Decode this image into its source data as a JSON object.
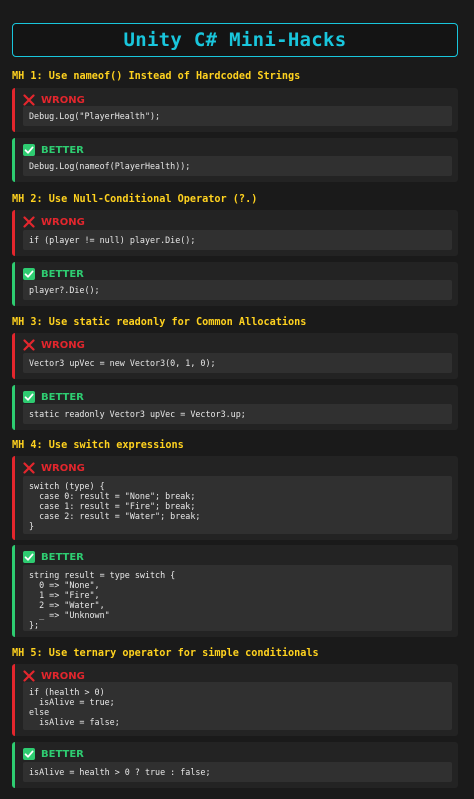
{
  "header": {
    "title": "Unity C# Mini-Hacks"
  },
  "labels": {
    "wrong": "WRONG",
    "better": "BETTER"
  },
  "icons": {
    "wrong": "x-icon",
    "better": "check-icon"
  },
  "colors": {
    "accent": "#19c6dc",
    "section_title": "#ffd21f",
    "wrong": "#e3262d",
    "better": "#2ecc71"
  },
  "hacks": [
    {
      "title": "MH 1: Use nameof() Instead of Hardcoded Strings",
      "wrong_code": "Debug.Log(\"PlayerHealth\");",
      "better_code": "Debug.Log(nameof(PlayerHealth));"
    },
    {
      "title": "MH 2: Use Null-Conditional Operator (?.)",
      "wrong_code": "if (player != null) player.Die();",
      "better_code": "player?.Die();"
    },
    {
      "title": "MH 3: Use static readonly for Common Allocations",
      "wrong_code": "Vector3 upVec = new Vector3(0, 1, 0);",
      "better_code": "static readonly Vector3 upVec = Vector3.up;"
    },
    {
      "title": "MH 4: Use switch expressions",
      "wrong_code": "switch (type) {\n  case 0: result = \"None\"; break;\n  case 1: result = \"Fire\"; break;\n  case 2: result = \"Water\"; break;\n}",
      "better_code": "string result = type switch {\n  0 => \"None\",\n  1 => \"Fire\",\n  2 => \"Water\",\n  _ => \"Unknown\"\n};"
    },
    {
      "title": "MH 5: Use ternary operator for simple conditionals",
      "wrong_code": "if (health > 0)\n  isAlive = true;\nelse\n  isAlive = false;",
      "better_code": "isAlive = health > 0 ? true : false;"
    }
  ]
}
